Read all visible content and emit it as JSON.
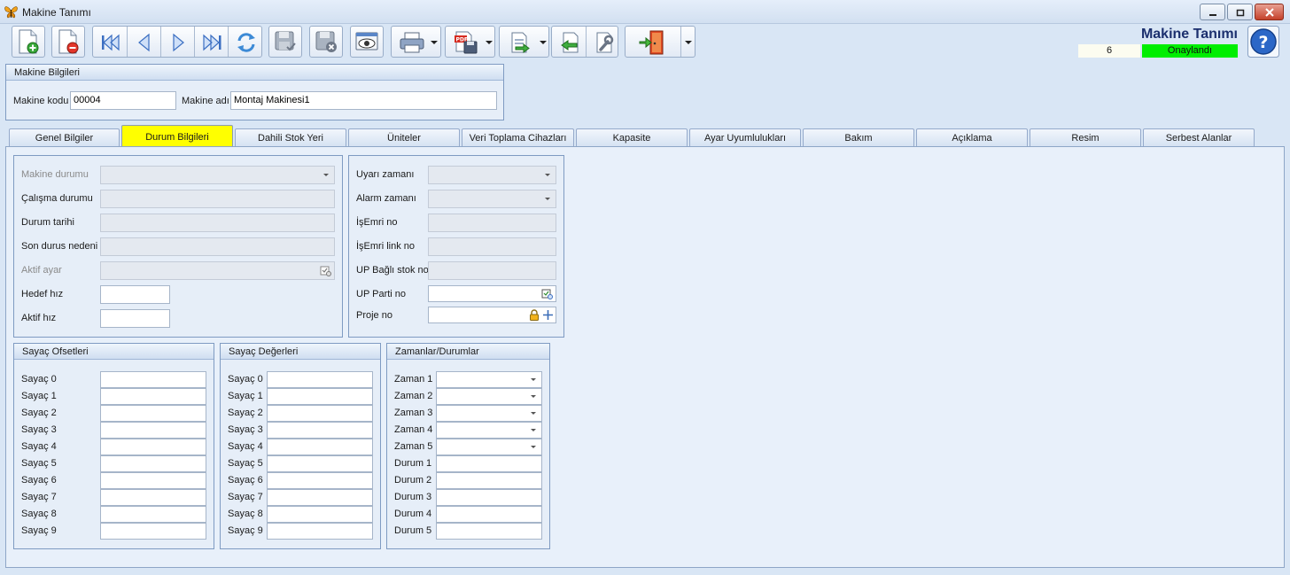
{
  "window": {
    "title": "Makine Tanımı"
  },
  "header": {
    "title": "Makine Tanımı",
    "record_count": "6",
    "status": "Onaylandı"
  },
  "machine_info": {
    "heading": "Makine Bilgileri",
    "code_label": "Makine kodu",
    "code_value": "00004",
    "name_label": "Makine adı",
    "name_value": "Montaj Makinesi1"
  },
  "tabs": [
    {
      "label": "Genel Bilgiler"
    },
    {
      "label": "Durum Bilgileri"
    },
    {
      "label": "Dahili Stok Yeri"
    },
    {
      "label": "Üniteler"
    },
    {
      "label": "Veri Toplama Cihazları"
    },
    {
      "label": "Kapasite"
    },
    {
      "label": "Ayar Uyumlulukları"
    },
    {
      "label": "Bakım"
    },
    {
      "label": "Açıklama"
    },
    {
      "label": "Resim"
    },
    {
      "label": "Serbest Alanlar"
    }
  ],
  "status_left": {
    "makine_durumu": "Makine durumu",
    "calisma_durumu": "Çalışma durumu",
    "durum_tarihi": "Durum tarihi",
    "son_durus_nedeni": "Son durus nedeni",
    "aktif_ayar": "Aktif ayar",
    "hedef_hiz": "Hedef hız",
    "aktif_hiz": "Aktif hız"
  },
  "status_right": {
    "uyari_zamani": "Uyarı zamanı",
    "alarm_zamani": "Alarm zamanı",
    "isemri_no": "İşEmri no",
    "isemri_link_no": "İşEmri link no",
    "up_bagli_stok_no": "UP Bağlı stok no",
    "up_parti_no": "UP Parti no",
    "proje_no": "Proje no"
  },
  "counter_offsets": {
    "heading": "Sayaç Ofsetleri",
    "labels": [
      "Sayaç 0",
      "Sayaç 1",
      "Sayaç 2",
      "Sayaç 3",
      "Sayaç 4",
      "Sayaç 5",
      "Sayaç 6",
      "Sayaç 7",
      "Sayaç 8",
      "Sayaç 9"
    ]
  },
  "counter_values": {
    "heading": "Sayaç Değerleri",
    "labels": [
      "Sayaç 0",
      "Sayaç 1",
      "Sayaç 2",
      "Sayaç 3",
      "Sayaç 4",
      "Sayaç 5",
      "Sayaç 6",
      "Sayaç 7",
      "Sayaç 8",
      "Sayaç 9"
    ]
  },
  "times_states": {
    "heading": "Zamanlar/Durumlar",
    "labels": [
      "Zaman 1",
      "Zaman 2",
      "Zaman 3",
      "Zaman 4",
      "Zaman 5",
      "Durum 1",
      "Durum 2",
      "Durum 3",
      "Durum 4",
      "Durum 5"
    ]
  },
  "colors": {
    "active_tab": "#ffff00",
    "status_ok": "#00ee00",
    "title_blue": "#1b2f6e"
  }
}
